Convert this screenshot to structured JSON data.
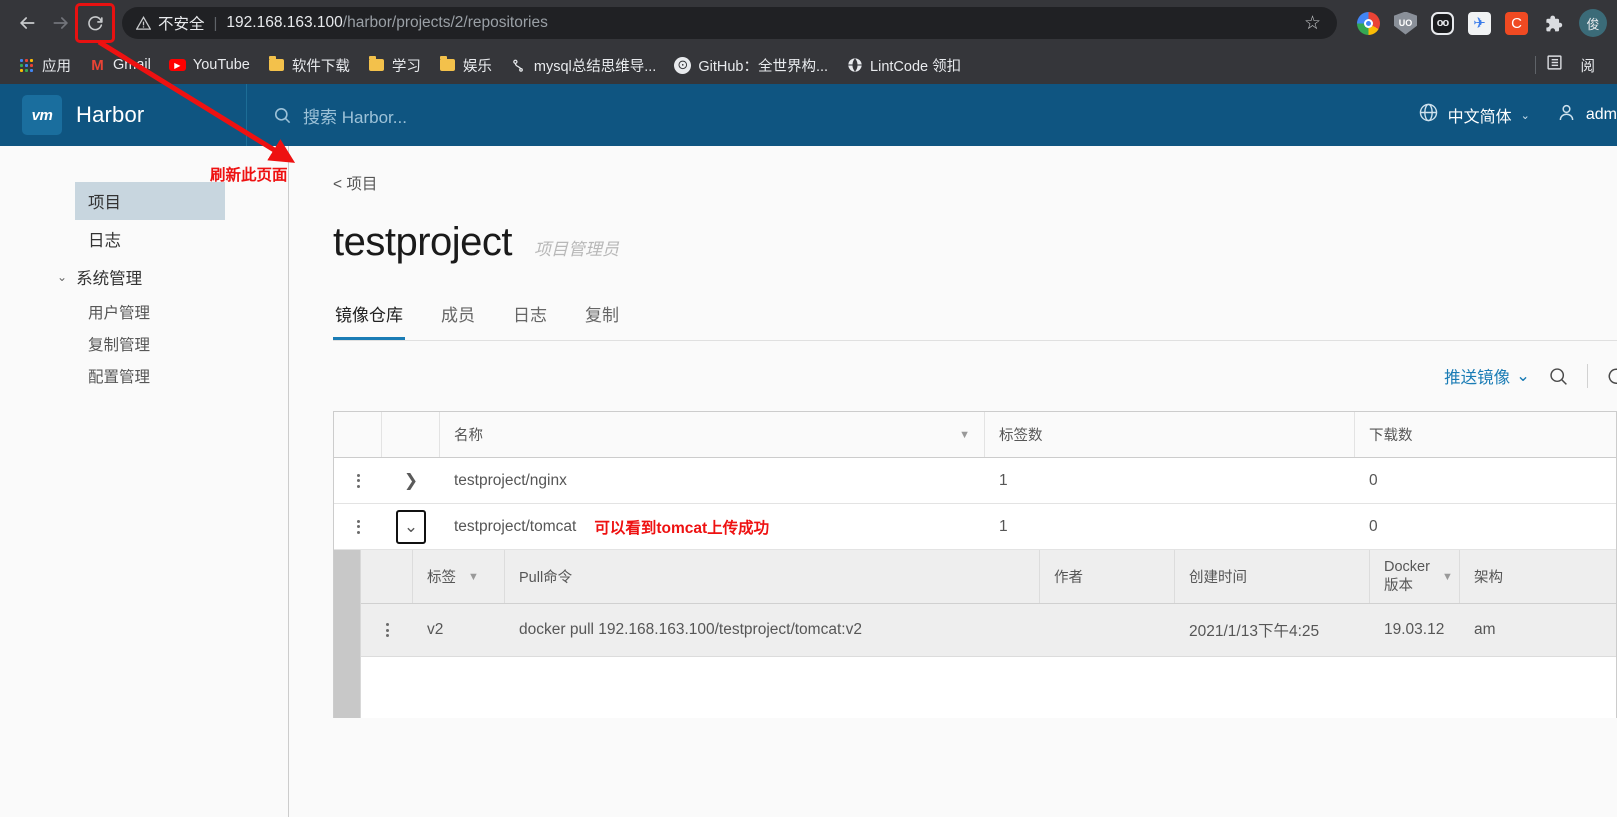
{
  "browser": {
    "back_icon": "back-arrow-icon",
    "forward_icon": "forward-arrow-icon",
    "reload_icon": "reload-icon",
    "security_label": "不安全",
    "url_host": "192.168.163.100",
    "url_path": "/harbor/projects/2/repositories",
    "star_icon": "bookmark-star-icon",
    "extensions": [
      {
        "name": "chrome-icon",
        "label": ""
      },
      {
        "name": "shield-extension-icon",
        "label": "UO"
      },
      {
        "name": "goggles-extension-icon",
        "label": "oo"
      },
      {
        "name": "bird-extension-icon",
        "label": "✈"
      },
      {
        "name": "c-extension-icon",
        "label": "C"
      },
      {
        "name": "puzzle-extensions-icon",
        "label": "🧩"
      },
      {
        "name": "profile-avatar",
        "label": "俊"
      }
    ],
    "bookmarks": [
      {
        "label": "应用",
        "icon": "apps-grid-icon"
      },
      {
        "label": "Gmail",
        "icon": "gmail-icon"
      },
      {
        "label": "YouTube",
        "icon": "youtube-icon"
      },
      {
        "label": "软件下载",
        "icon": "folder-icon"
      },
      {
        "label": "学习",
        "icon": "folder-icon"
      },
      {
        "label": "娱乐",
        "icon": "folder-icon"
      },
      {
        "label": "mysql总结思维导...",
        "icon": "mindmap-icon"
      },
      {
        "label": "GitHub：全世界构...",
        "icon": "github-icon"
      },
      {
        "label": "LintCode 领扣",
        "icon": "globe-icon"
      }
    ],
    "reading_list_label": "阅",
    "reading_list_icon": "reading-list-icon"
  },
  "annotations": {
    "refresh_note": "刷新此页面",
    "tomcat_note": "可以看到tomcat上传成功",
    "color": "#ee1111"
  },
  "harbor_header": {
    "logo_text": "vm",
    "brand": "Harbor",
    "search_placeholder": "搜索 Harbor...",
    "search_icon": "search-icon",
    "language": "中文简体",
    "language_icon": "globe-icon",
    "user": "adm",
    "user_icon": "user-icon",
    "bg_color": "#0f5581"
  },
  "sidebar": {
    "items": [
      {
        "label": "项目",
        "active": true
      },
      {
        "label": "日志",
        "active": false
      }
    ],
    "group": {
      "label": "系统管理",
      "chevron_icon": "chevron-down-icon",
      "children": [
        {
          "label": "用户管理"
        },
        {
          "label": "复制管理"
        },
        {
          "label": "配置管理"
        }
      ]
    }
  },
  "main": {
    "breadcrumb": "< 项目",
    "title": "testproject",
    "role": "项目管理员",
    "tabs": [
      {
        "label": "镜像仓库",
        "active": true
      },
      {
        "label": "成员",
        "active": false
      },
      {
        "label": "日志",
        "active": false
      },
      {
        "label": "复制",
        "active": false
      }
    ],
    "actions": {
      "push_image": "推送镜像",
      "push_chevron_icon": "chevron-down-icon",
      "search_icon": "search-icon",
      "refresh_icon": "refresh-icon"
    },
    "table": {
      "columns": [
        "名称",
        "标签数",
        "下载数"
      ],
      "filter_icon": "funnel-filter-icon",
      "rows": [
        {
          "name": "testproject/nginx",
          "tag_count": "1",
          "download_count": "0",
          "expanded": false,
          "expand_icon": "chevron-right-icon"
        },
        {
          "name": "testproject/tomcat",
          "tag_count": "1",
          "download_count": "0",
          "expanded": true,
          "expand_icon": "chevron-down-icon"
        }
      ],
      "menu_icon": "kebab-menu-icon"
    },
    "subtable": {
      "columns": [
        "标签",
        "Pull命令",
        "作者",
        "创建时间",
        "Docker 版本",
        "架构"
      ],
      "docker_version_l1": "Docker",
      "docker_version_l2": "版本",
      "rows": [
        {
          "tag": "v2",
          "pull_command": "docker pull 192.168.163.100/testproject/tomcat:v2",
          "author": "",
          "created": "2021/1/13下午4:25",
          "docker_version": "19.03.12",
          "arch": "am"
        }
      ]
    }
  }
}
